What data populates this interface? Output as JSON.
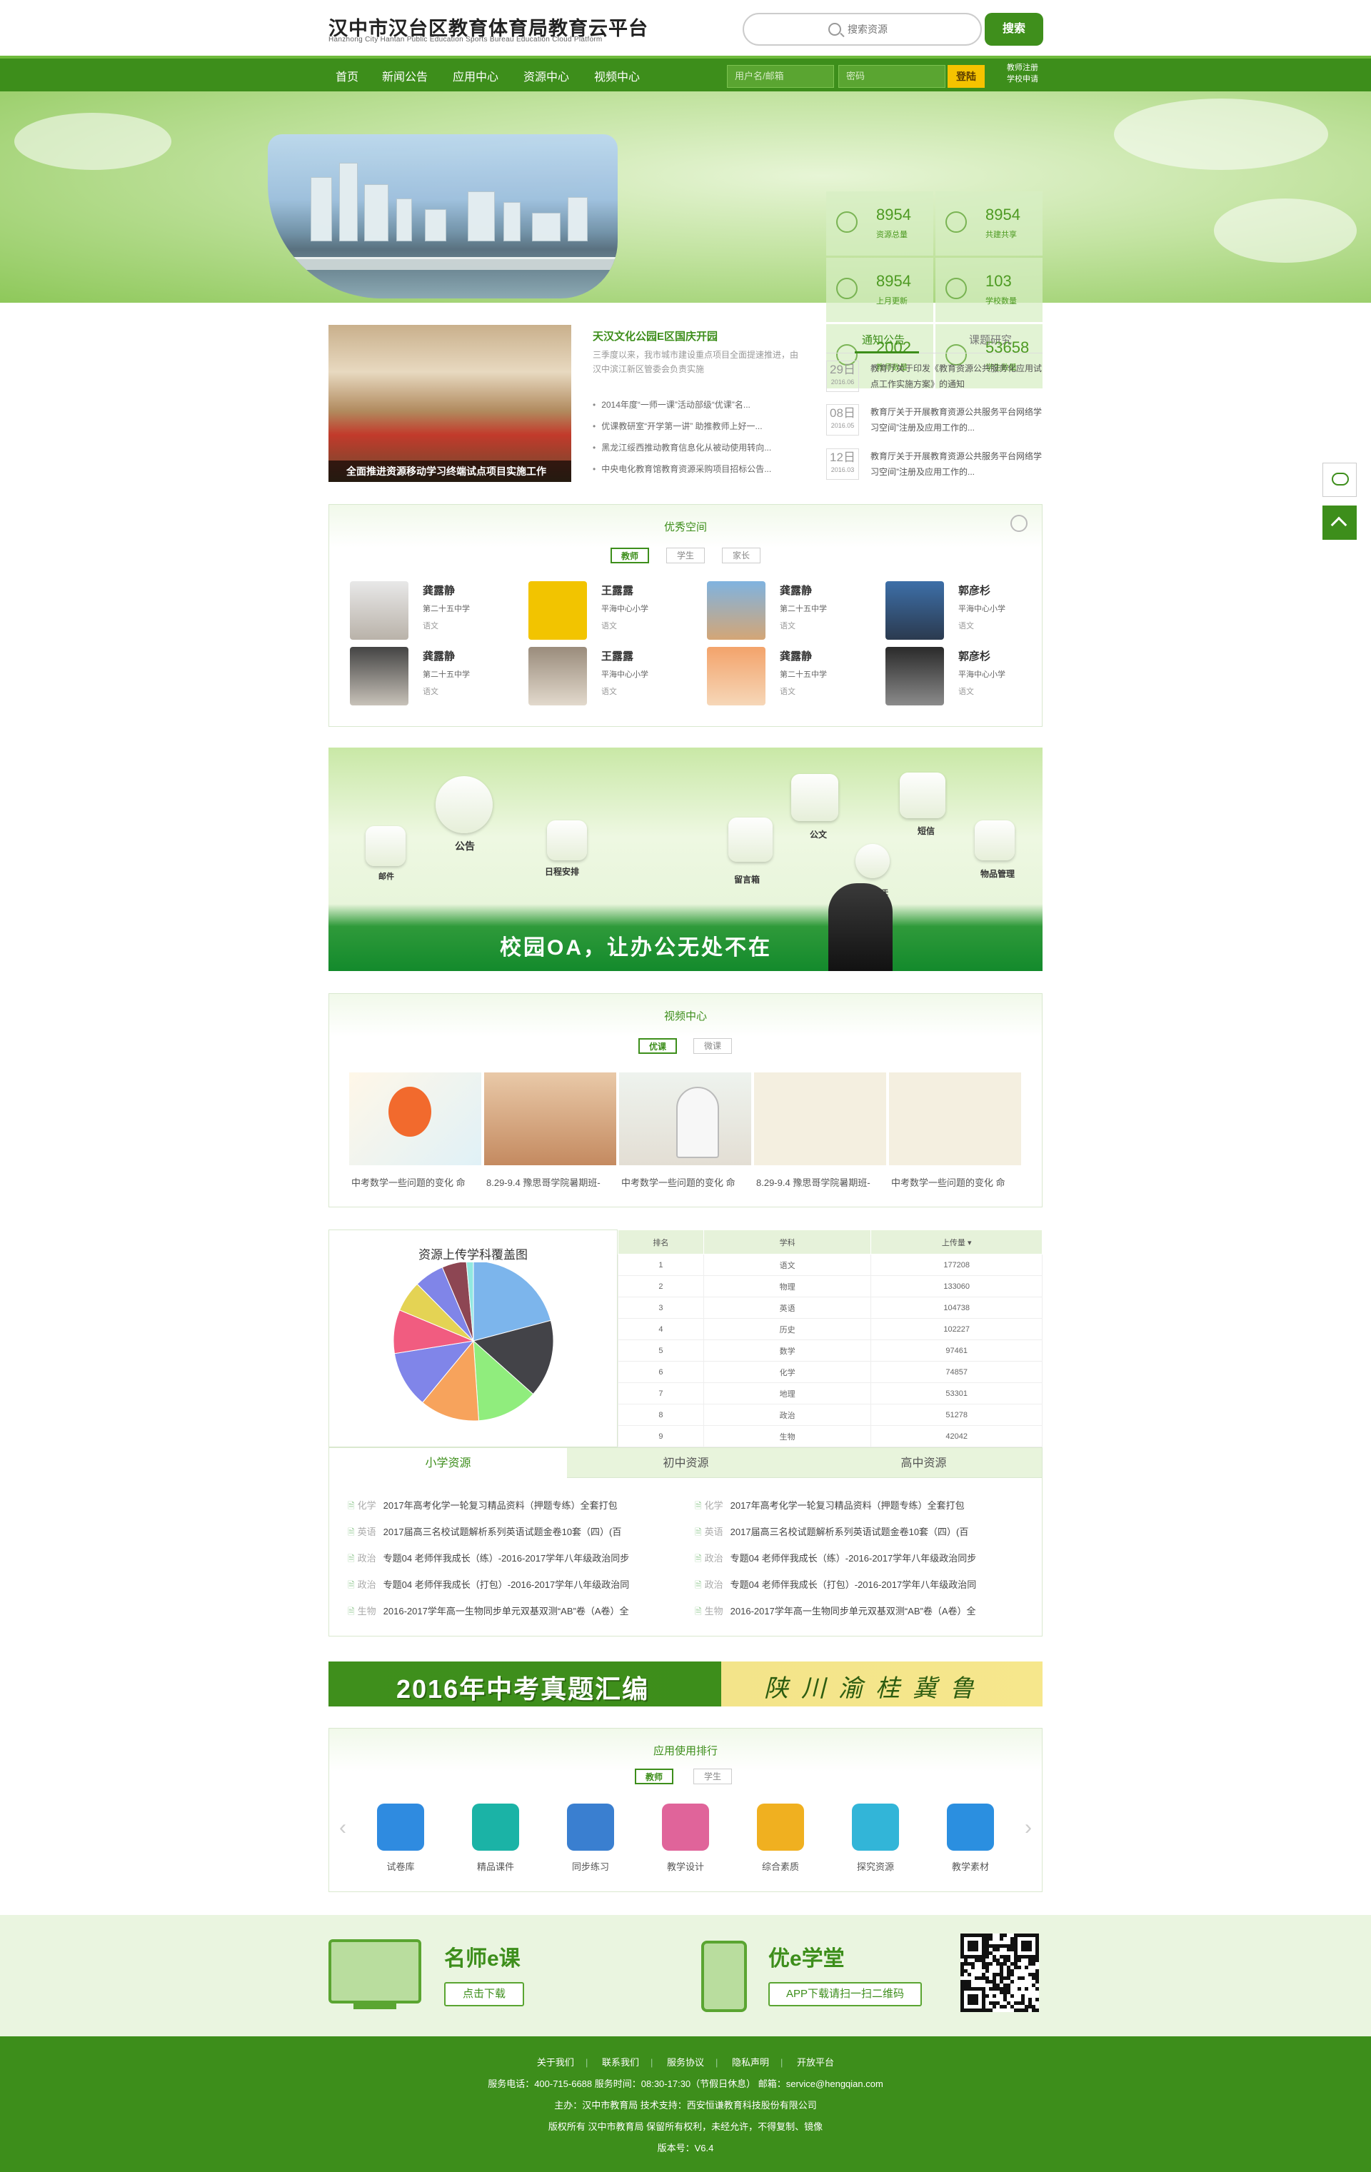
{
  "header": {
    "logo_cn": "汉中市汉台区教育体育局教育云平台",
    "logo_en": "Hanzhong City Hantan Public Education Sports Bureau Education Cloud Platform",
    "search_placeholder": "搜索资源",
    "search_button": "搜索"
  },
  "nav": {
    "items": [
      "首页",
      "新闻公告",
      "应用中心",
      "资源中心",
      "视频中心"
    ],
    "username_placeholder": "用户名/邮箱",
    "password_placeholder": "密码",
    "login": "登陆",
    "teacher_register": "教师注册",
    "school_register": "学校申请"
  },
  "stats": [
    {
      "num": "8954",
      "label": "资源总量",
      "icon": "book-icon"
    },
    {
      "num": "8954",
      "label": "共建共享",
      "icon": "folder-icon"
    },
    {
      "num": "8954",
      "label": "上月更新",
      "icon": "arrow-up-icon"
    },
    {
      "num": "103",
      "label": "学校数量",
      "icon": "building-icon"
    },
    {
      "num": "2002",
      "label": "教师数量",
      "icon": "teacher-icon"
    },
    {
      "num": "53658",
      "label": "学生数量",
      "icon": "student-icon"
    }
  ],
  "news": {
    "image_caption": "全面推进资源移动学习终端试点项目实施工作",
    "headline": "天汉文化公园E区国庆开园",
    "summary": "三季度以来，我市城市建设重点项目全面提速推进，由汉中滨江新区管委会负责实施",
    "items": [
      "2014年度“一师一课”活动部级“优课”名...",
      "优课教研室“开学第一讲” 助推教师上好一...",
      "黑龙江绥西推动教育信息化从被动使用转向...",
      "中央电化教育馆教育资源采购项目招标公告..."
    ]
  },
  "notices": {
    "tabs": [
      "通知公告",
      "课题研究"
    ],
    "items": [
      {
        "day": "29日",
        "ym": "2016.06",
        "text": "教育厅关于印发《教育资源公共服务化应用试点工作实施方案》的通知"
      },
      {
        "day": "08日",
        "ym": "2016.05",
        "text": "教育厅关于开展教育资源公共服务平台网络学习空间”注册及应用工作的..."
      },
      {
        "day": "12日",
        "ym": "2016.03",
        "text": "教育厅关于开展教育资源公共服务平台网络学习空间”注册及应用工作的..."
      }
    ]
  },
  "space": {
    "title": "优秀空间",
    "tabs": [
      "教师",
      "学生",
      "家长"
    ],
    "people": [
      {
        "name": "龚露静",
        "school": "第二十五中学",
        "subject": "语文"
      },
      {
        "name": "王露露",
        "school": "平海中心小学",
        "subject": "语文"
      },
      {
        "name": "龚露静",
        "school": "第二十五中学",
        "subject": "语文"
      },
      {
        "name": "郭彦杉",
        "school": "平海中心小学",
        "subject": "语文"
      },
      {
        "name": "龚露静",
        "school": "第二十五中学",
        "subject": "语文"
      },
      {
        "name": "王露露",
        "school": "平海中心小学",
        "subject": "语文"
      },
      {
        "name": "龚露静",
        "school": "第二十五中学",
        "subject": "语文"
      },
      {
        "name": "郭彦杉",
        "school": "平海中心小学",
        "subject": "语文"
      }
    ]
  },
  "oa": {
    "labels": [
      "邮件",
      "公告",
      "日程安排",
      "留言箱",
      "公文",
      "在线聊天",
      "短信",
      "物品管理"
    ],
    "slogan": "校园OA，让办公无处不在"
  },
  "video": {
    "title": "视频中心",
    "tabs": [
      "优课",
      "微课"
    ],
    "captions": [
      "中考数学一些问题的变化 命",
      "8.29-9.4 豫思哥学院暑期班-",
      "中考数学一些问题的变化 命",
      "8.29-9.4 豫思哥学院暑期班-",
      "中考数学一些问题的变化 命"
    ]
  },
  "chart_data": {
    "type": "pie",
    "title": "资源上传学科覆盖图",
    "categories": [
      "语文",
      "物理",
      "英语",
      "历史",
      "数学",
      "化学",
      "地理",
      "政治",
      "生物",
      "其他"
    ],
    "values": [
      177208,
      133060,
      104738,
      102227,
      97461,
      74857,
      53301,
      51278,
      42042,
      12000
    ],
    "colors": [
      "#7cb5ec",
      "#434348",
      "#90ed7d",
      "#f7a35c",
      "#8085e9",
      "#f15c80",
      "#e4d354",
      "#8085e8",
      "#8d4653",
      "#91e8e1"
    ]
  },
  "ranking": {
    "headers": [
      "排名",
      "学科",
      "上传量"
    ],
    "rows": [
      [
        "1",
        "语文",
        "177208"
      ],
      [
        "2",
        "物理",
        "133060"
      ],
      [
        "3",
        "英语",
        "104738"
      ],
      [
        "4",
        "历史",
        "102227"
      ],
      [
        "5",
        "数学",
        "97461"
      ],
      [
        "6",
        "化学",
        "74857"
      ],
      [
        "7",
        "地理",
        "53301"
      ],
      [
        "8",
        "政治",
        "51278"
      ],
      [
        "9",
        "生物",
        "42042"
      ]
    ]
  },
  "resources": {
    "tabs": [
      "小学资源",
      "初中资源",
      "高中资源"
    ],
    "items": [
      {
        "tag": "化学",
        "title": "2017年高考化学一轮复习精品资料（押题专练）全套打包"
      },
      {
        "tag": "英语",
        "title": "2017届高三名校试题解析系列英语试题金卷10套（四）(百"
      },
      {
        "tag": "政治",
        "title": "专题04 老师伴我成长（练）-2016-2017学年八年级政治同步"
      },
      {
        "tag": "政治",
        "title": "专题04 老师伴我成长（打包）-2016-2017学年八年级政治同"
      },
      {
        "tag": "生物",
        "title": "2016-2017学年高一生物同步单元双基双测“AB”卷（A卷）全"
      }
    ],
    "items_right": [
      {
        "tag": "化学",
        "title": "2017年高考化学一轮复习精品资料（押题专练）全套打包"
      },
      {
        "tag": "英语",
        "title": "2017届高三名校试题解析系列英语试题金卷10套（四）(百"
      },
      {
        "tag": "政治",
        "title": "专题04 老师伴我成长（练）-2016-2017学年八年级政治同步"
      },
      {
        "tag": "政治",
        "title": "专题04 老师伴我成长（打包）-2016-2017学年八年级政治同"
      },
      {
        "tag": "生物",
        "title": "2016-2017学年高一生物同步单元双基双测“AB”卷（A卷）全"
      }
    ]
  },
  "exam_banner": {
    "title": "2016年中考真题汇编",
    "provinces": "陕川渝桂冀鲁"
  },
  "apps": {
    "title": "应用使用排行",
    "tabs": [
      "教师",
      "学生"
    ],
    "items": [
      {
        "name": "试卷库",
        "color": "#2f8be0"
      },
      {
        "name": "精品课件",
        "color": "#1bb3a6"
      },
      {
        "name": "同步练习",
        "color": "#3a7fd0"
      },
      {
        "name": "教学设计",
        "color": "#e0649a"
      },
      {
        "name": "综合素质",
        "color": "#f0b020"
      },
      {
        "name": "探究资源",
        "color": "#32b5d8"
      },
      {
        "name": "教学素材",
        "color": "#2b8fe0"
      }
    ]
  },
  "promo": {
    "mooc": "名师e课",
    "download": "点击下载",
    "ystudy": "优e学堂",
    "app_qr": "APP下载请扫一扫二维码"
  },
  "footer": {
    "links": [
      "关于我们",
      "联系我们",
      "服务协议",
      "隐私声明",
      "开放平台"
    ],
    "contact": "服务电话：400-715-6688 服务时间：08:30-17:30（节假日休息） 邮箱：service@hengqian.com",
    "host": "主办：汉中市教育局 技术支持：西安恒谦教育科技股份有限公司",
    "copyright": "版权所有 汉中市教育局 保留所有权利，未经允许，不得复制、镜像",
    "version": "版本号：V6.4"
  }
}
